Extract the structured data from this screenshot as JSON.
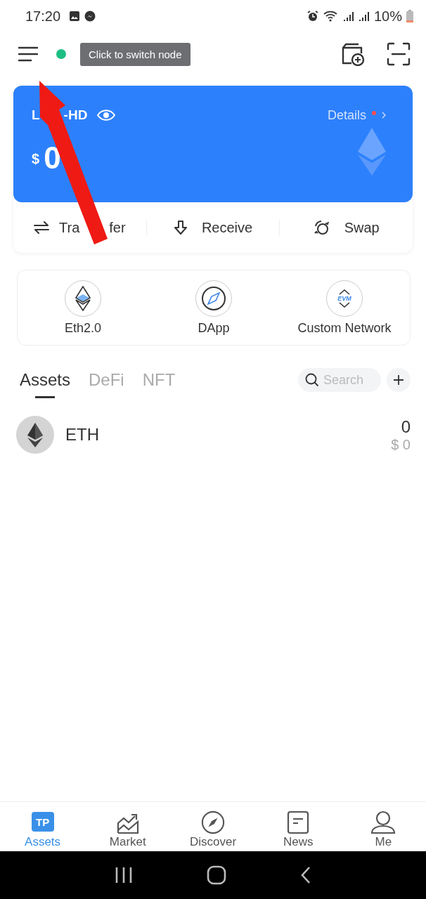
{
  "status_bar": {
    "time": "17:20",
    "battery": "10%"
  },
  "header": {
    "tooltip": "Click to switch node"
  },
  "wallet": {
    "name_parts": [
      "L",
      "-HD"
    ],
    "details": "Details",
    "currency": "$",
    "balance": "0"
  },
  "actions": [
    {
      "kind": "transfer",
      "parts": [
        "Tra",
        "fer"
      ]
    },
    {
      "kind": "receive",
      "parts": [
        "Receive"
      ]
    },
    {
      "kind": "swap",
      "parts": [
        "Swap"
      ]
    }
  ],
  "shortcuts": [
    {
      "kind": "eth2",
      "label": "Eth2.0"
    },
    {
      "kind": "dapp",
      "label": "DApp"
    },
    {
      "kind": "evm",
      "label": "Custom Network",
      "icon_text": "EVM"
    }
  ],
  "tabs": [
    {
      "label": "Assets",
      "selected": true
    },
    {
      "label": "DeFi",
      "selected": false
    },
    {
      "label": "NFT",
      "selected": false
    }
  ],
  "search": {
    "placeholder": "Search"
  },
  "assets": [
    {
      "symbol": "ETH",
      "amount": "0",
      "value": "$ 0"
    }
  ],
  "bottom_nav": [
    {
      "kind": "assets",
      "label": "Assets",
      "selected": true,
      "logo_text": "TP"
    },
    {
      "kind": "market",
      "label": "Market",
      "selected": false
    },
    {
      "kind": "discover",
      "label": "Discover",
      "selected": false
    },
    {
      "kind": "news",
      "label": "News",
      "selected": false
    },
    {
      "kind": "me",
      "label": "Me",
      "selected": false
    }
  ]
}
